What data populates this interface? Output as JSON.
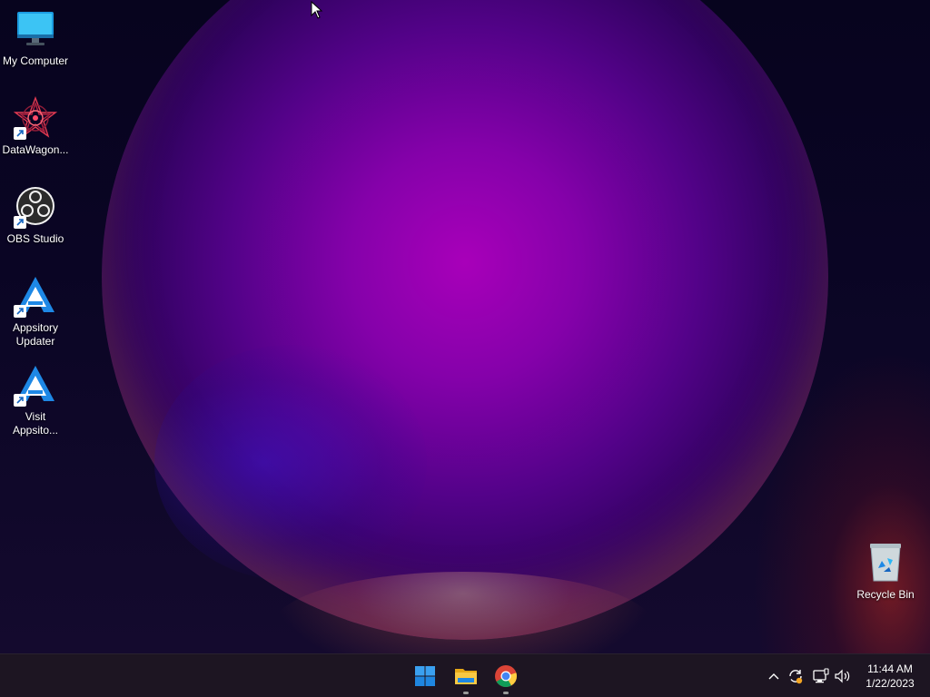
{
  "desktop": {
    "icons": [
      {
        "label": "My Computer",
        "icon": "monitor-icon"
      },
      {
        "label": "DataWagon...",
        "icon": "datawagon-icon",
        "shortcut": true
      },
      {
        "label": "OBS Studio",
        "icon": "obs-icon",
        "shortcut": true
      },
      {
        "label": "Appsitory Updater",
        "icon": "appsitory-icon",
        "shortcut": true
      },
      {
        "label": "Visit Appsito...",
        "icon": "appsitory-icon",
        "shortcut": true
      },
      {
        "label": "Recycle Bin",
        "icon": "recycle-bin-icon"
      }
    ]
  },
  "taskbar": {
    "pinned": [
      {
        "name": "Start",
        "icon": "windows-start-icon",
        "running": false
      },
      {
        "name": "File Explorer",
        "icon": "folder-icon",
        "running": true
      },
      {
        "name": "Google Chrome",
        "icon": "chrome-icon",
        "running": true
      }
    ],
    "tray": {
      "icons": [
        "chevron-up-icon",
        "update-icon",
        "network-icon",
        "volume-icon"
      ],
      "time": "11:44 AM",
      "date": "1/22/2023"
    }
  },
  "colors": {
    "taskbar_bg": "#1e1622",
    "accent_blue": "#0a84d8",
    "orb_core": "#af00be"
  }
}
